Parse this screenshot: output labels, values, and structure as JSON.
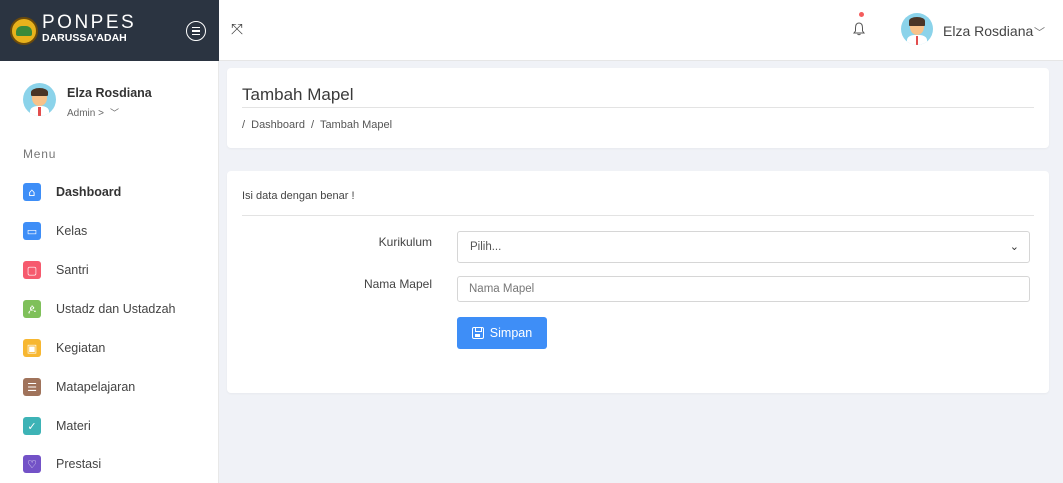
{
  "brand": {
    "title": "PONPES",
    "subtitle": "DARUSSA'ADAH"
  },
  "sidebar": {
    "user_name": "Elza Rosdiana",
    "user_role": "Admin >",
    "menu_heading": "Menu",
    "items": [
      {
        "label": "Dashboard",
        "icon": "home-icon",
        "color": "#3e8ef7",
        "glyph": "⌂"
      },
      {
        "label": "Kelas",
        "icon": "monitor-icon",
        "color": "#3e8ef7",
        "glyph": "▭"
      },
      {
        "label": "Santri",
        "icon": "calendar-icon",
        "color": "#f65a6e",
        "glyph": "▢"
      },
      {
        "label": "Ustadz dan Ustadzah",
        "icon": "user-icon",
        "color": "#7fc05a",
        "glyph": "ዾ"
      },
      {
        "label": "Kegiatan",
        "icon": "image-icon",
        "color": "#f7b731",
        "glyph": "▣"
      },
      {
        "label": "Matapelajaran",
        "icon": "list-icon",
        "color": "#a0735b",
        "glyph": "☰"
      },
      {
        "label": "Materi",
        "icon": "check-icon",
        "color": "#3db3b6",
        "glyph": "✓"
      },
      {
        "label": "Prestasi",
        "icon": "trophy-icon",
        "color": "#7352c7",
        "glyph": "♡"
      }
    ]
  },
  "topbar": {
    "user_name": "Elza Rosdiana"
  },
  "page": {
    "title": "Tambah Mapel",
    "breadcrumb": [
      "/",
      "Dashboard",
      "/",
      "Tambah Mapel"
    ]
  },
  "form": {
    "note": "Isi data dengan benar !",
    "kurikulum_label": "Kurikulum",
    "kurikulum_value": "Pilih...",
    "nama_label": "Nama Mapel",
    "nama_placeholder": "Nama Mapel",
    "save_label": "Simpan"
  }
}
